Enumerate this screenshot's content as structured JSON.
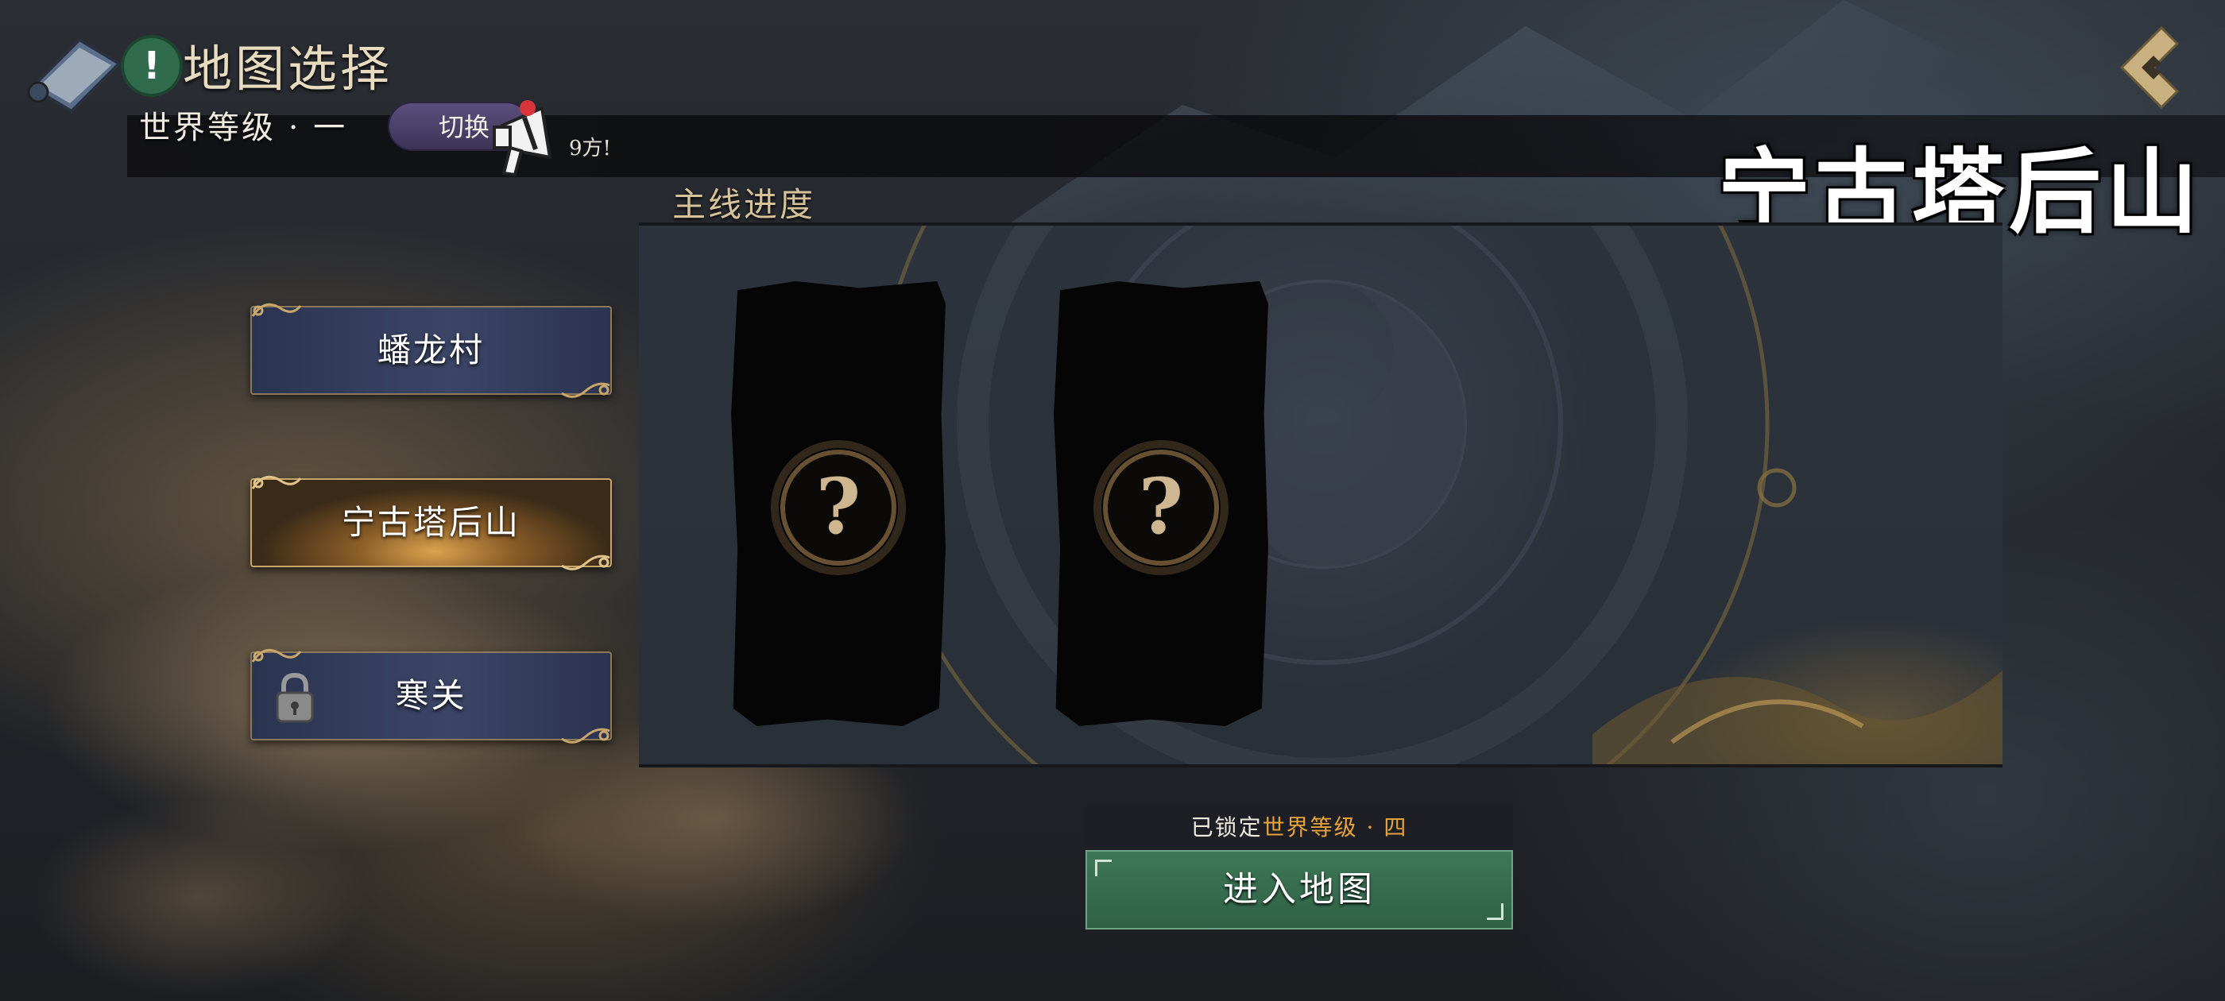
{
  "header": {
    "title": "地图选择",
    "world_level": "世界等级 · 一",
    "switch_label": "切换",
    "notice_text": "9方!"
  },
  "selected_map": {
    "name": "宁古塔后山"
  },
  "map_list": [
    {
      "label": "蟠龙村",
      "state": "unlocked"
    },
    {
      "label": "宁古塔后山",
      "state": "selected"
    },
    {
      "label": "寒关",
      "state": "locked"
    }
  ],
  "progress": {
    "title": "主线进度",
    "cards": [
      {
        "state": "unknown",
        "icon": "question-mark-icon"
      },
      {
        "state": "unknown",
        "icon": "question-mark-icon"
      }
    ]
  },
  "action": {
    "lock_prefix": "已锁定",
    "lock_level": "世界等级 · 四",
    "enter_label": "进入地图"
  },
  "colors": {
    "accent_gold": "#e8a33c",
    "enter_green": "#3e7758",
    "switch_purple": "#5b4f7c",
    "alert_green": "#2f6b4c"
  }
}
